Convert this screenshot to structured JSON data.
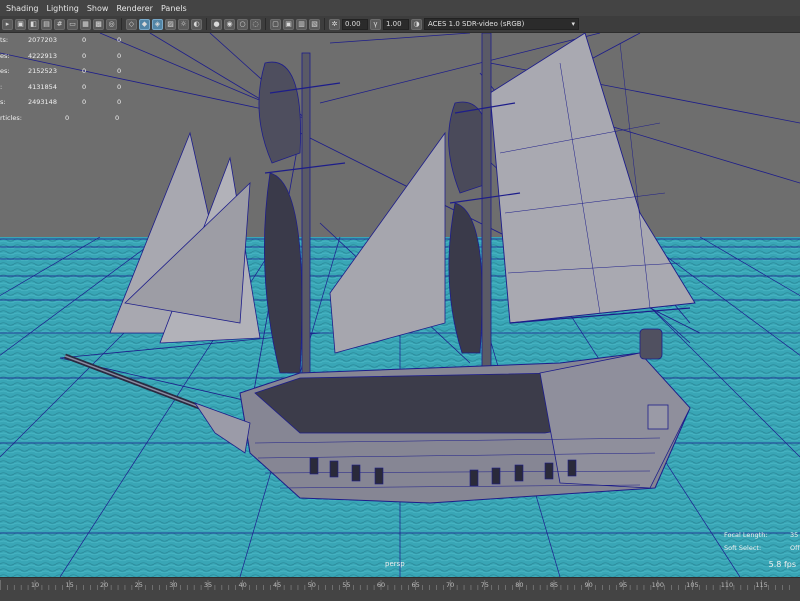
{
  "menu": [
    "Shading",
    "Lighting",
    "Show",
    "Renderer",
    "Panels"
  ],
  "toolbar": {
    "field1": "0.00",
    "field2": "1.00",
    "color_space": "ACES 1.0 SDR-video (sRGB)"
  },
  "hud_stats": [
    {
      "label": "ts:",
      "v1": "2077203",
      "v2": "0",
      "v3": "0"
    },
    {
      "label": "es:",
      "v1": "4222913",
      "v2": "0",
      "v3": "0"
    },
    {
      "label": "es:",
      "v1": "2152523",
      "v2": "0",
      "v3": "0"
    },
    {
      "label": ":",
      "v1": "4131854",
      "v2": "0",
      "v3": "0"
    },
    {
      "label": "s:",
      "v1": "2493148",
      "v2": "0",
      "v3": "0"
    },
    {
      "label": "rticles:",
      "v1": "",
      "v2": "0",
      "v3": "0"
    }
  ],
  "hud_right": [
    {
      "key": "Focal Length:",
      "value": "35"
    },
    {
      "key": "Soft Select:",
      "value": "Off"
    }
  ],
  "camera": "persp",
  "fps": "5.8 fps",
  "timeline_ticks": [
    "10",
    "15",
    "20",
    "25",
    "30",
    "35",
    "40",
    "45",
    "50",
    "55",
    "60",
    "65",
    "70",
    "75",
    "80",
    "85",
    "90",
    "95",
    "100",
    "105",
    "110",
    "115"
  ],
  "colors": {
    "viewport_bg": "#6e6e6e",
    "ocean": "#3aa8b8",
    "wire": "#1c1c8a",
    "sail": "#9a9aa3"
  },
  "icons": [
    "select-icon",
    "lasso-icon",
    "paint-icon",
    "move-icon",
    "rotate-icon",
    "scale-icon",
    "camera-icon",
    "grid-icon",
    "light-icon",
    "isolate-icon",
    "xray-icon",
    "exposure-icon",
    "gamma-icon"
  ]
}
